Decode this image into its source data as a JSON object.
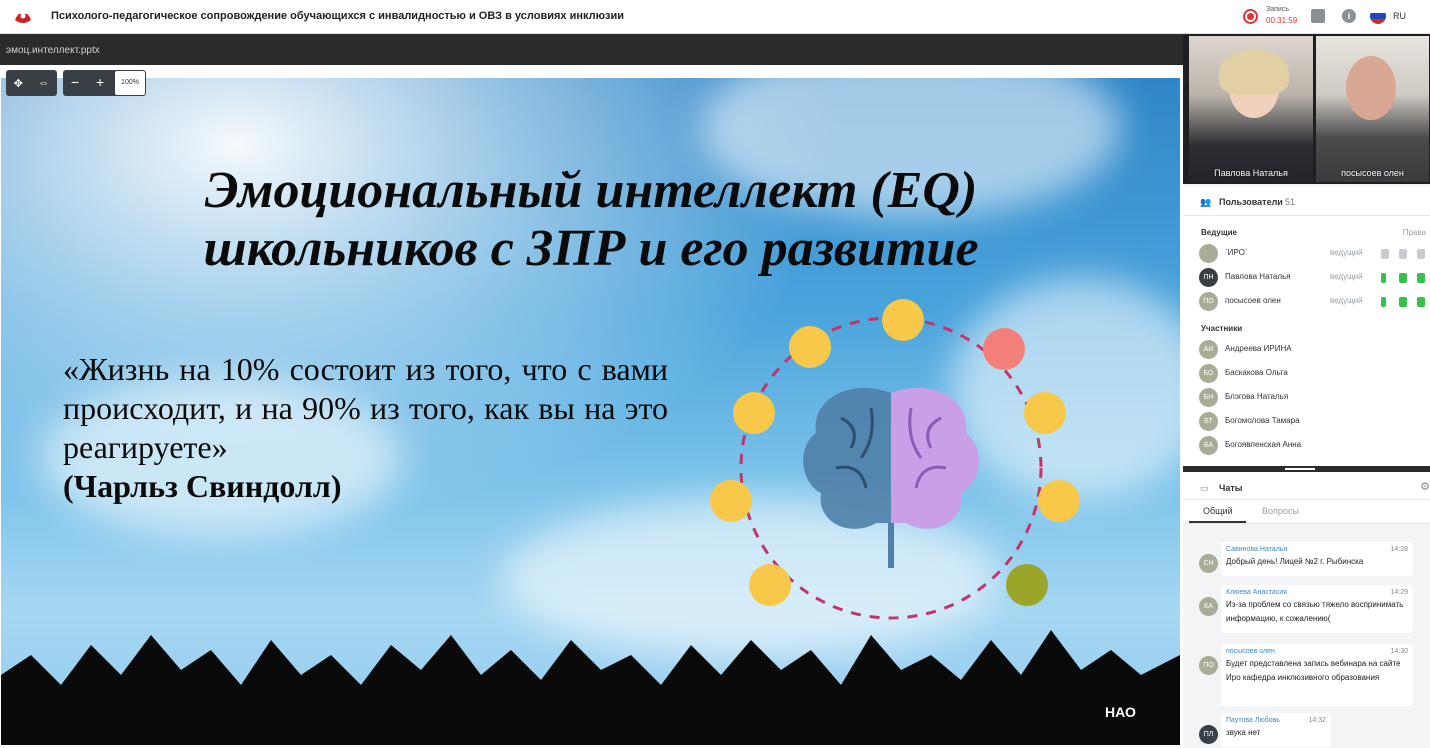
{
  "app": {
    "title": "Психолого-педагогическое сопровождение обучающихся с инвалидностью и ОВЗ в условиях инклюзии",
    "record_label": "Запись",
    "record_time": "00:31:59",
    "language": "RU"
  },
  "presentation": {
    "file_name": "эмоц.интеллект.pptx",
    "zoom": "100%",
    "slide": {
      "title_line1": "Эмоциональный интеллект (EQ)",
      "title_line2": "школьников с ЗПР и его развитие",
      "quote": "«Жизнь на 10% состоит из того, что с вами происходит, и на 90% из того, как вы на это реагируете»",
      "author": "(Чарльз Свиндолл)"
    }
  },
  "videos": [
    {
      "name": "Павлова Наталья"
    },
    {
      "name": "посысоев олен"
    }
  ],
  "users": {
    "title": "Пользователи",
    "count": "51",
    "presenters_label": "Ведущие",
    "rights_label": "Права",
    "participants_label": "Участники",
    "presenters": [
      {
        "initials": "",
        "name": "`ИРО`",
        "role": "ведущий"
      },
      {
        "initials": "ПН",
        "name": "Павлова Наталья",
        "role": "ведущий"
      },
      {
        "initials": "ПО",
        "name": "посысоев олен",
        "role": "ведущий"
      }
    ],
    "participants": [
      {
        "initials": "АИ",
        "name": "Андреева ИРИНА"
      },
      {
        "initials": "БО",
        "name": "Баскакова Ольга"
      },
      {
        "initials": "БН",
        "name": "Блэгова Наталья"
      },
      {
        "initials": "БТ",
        "name": "Богомолова Тамара"
      },
      {
        "initials": "БА",
        "name": "Богоявленская Анна"
      }
    ]
  },
  "chat": {
    "title": "Чаты",
    "tabs": [
      "Общий",
      "Вопросы"
    ],
    "messages": [
      {
        "initials": "СН",
        "author": "Савинова Наталья",
        "time": "14:28",
        "text": "Добрый день! Лицей №2 г. Рыбинска"
      },
      {
        "initials": "КА",
        "author": "Клюева Анастасия",
        "time": "14:29",
        "text": "Из-за проблем со связью тяжело воспринимать информацию, к сожалению("
      },
      {
        "initials": "ПО",
        "author": "посысоев олен",
        "time": "14:30",
        "text": "Будет представлена запись вебинара на сайте Иро кафедра инклюзивного образования"
      },
      {
        "initials": "ПЛ",
        "author": "Паутова Любовь",
        "time": "14:32",
        "text": "звука нет"
      }
    ]
  },
  "colors": {
    "record": "#e0353a",
    "mic_on": "#36c24a",
    "avatar_bg": "#a7ad96",
    "author_link": "#3a8ac4"
  }
}
